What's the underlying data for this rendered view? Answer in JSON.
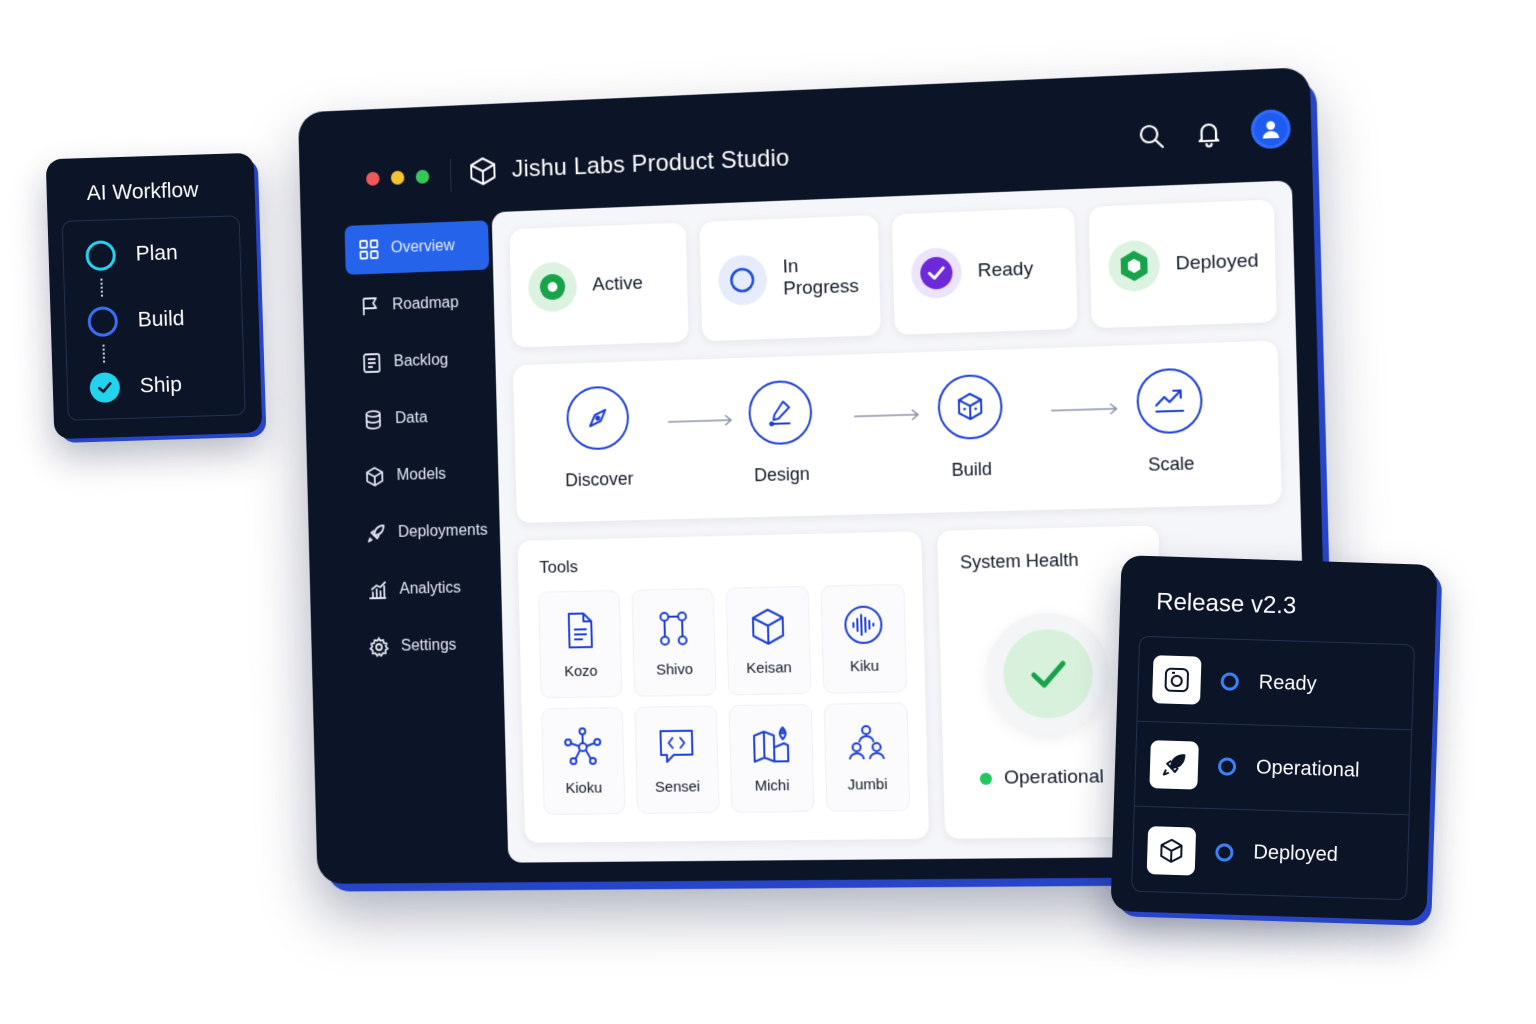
{
  "app": {
    "title": "Jishu Labs Product Studio"
  },
  "sidebar": {
    "items": [
      {
        "label": "Overview",
        "icon": "grid-icon",
        "active": true
      },
      {
        "label": "Roadmap",
        "icon": "flag-icon"
      },
      {
        "label": "Backlog",
        "icon": "list-icon"
      },
      {
        "label": "Data",
        "icon": "database-icon"
      },
      {
        "label": "Models",
        "icon": "cube-icon"
      },
      {
        "label": "Deployments",
        "icon": "rocket-icon"
      },
      {
        "label": "Analytics",
        "icon": "chart-icon"
      },
      {
        "label": "Settings",
        "icon": "gear-icon"
      }
    ]
  },
  "statuses": [
    {
      "label": "Active",
      "icon": "active-dot-icon",
      "color": "#16a34a"
    },
    {
      "label": "In Progress",
      "icon": "progress-ring-icon",
      "color": "#1d4ed8"
    },
    {
      "label": "Ready",
      "icon": "check-badge-icon",
      "color": "#6d28d9"
    },
    {
      "label": "Deployed",
      "icon": "hexagon-icon",
      "color": "#16a34a"
    }
  ],
  "flow": {
    "steps": [
      {
        "label": "Discover",
        "icon": "compass-icon"
      },
      {
        "label": "Design",
        "icon": "pen-tool-icon"
      },
      {
        "label": "Build",
        "icon": "box-icon"
      },
      {
        "label": "Scale",
        "icon": "trend-up-icon"
      }
    ]
  },
  "tools": {
    "title": "Tools",
    "items": [
      {
        "label": "Kozo",
        "icon": "document-icon"
      },
      {
        "label": "Shivo",
        "icon": "branch-icon"
      },
      {
        "label": "Keisan",
        "icon": "cube-icon"
      },
      {
        "label": "Kiku",
        "icon": "audio-wave-icon"
      },
      {
        "label": "Kioku",
        "icon": "network-icon"
      },
      {
        "label": "Sensei",
        "icon": "code-chat-icon"
      },
      {
        "label": "Michi",
        "icon": "map-pin-icon"
      },
      {
        "label": "Jumbi",
        "icon": "team-icon"
      }
    ]
  },
  "health": {
    "title": "System Health",
    "status": "Operational"
  },
  "workflow": {
    "title": "AI Workflow",
    "steps": [
      {
        "label": "Plan",
        "color": "#22d3ee"
      },
      {
        "label": "Build",
        "color": "#3b6df6"
      },
      {
        "label": "Ship",
        "color": "#22d3ee"
      }
    ]
  },
  "release": {
    "title": "Release v2.3",
    "items": [
      {
        "label": "Ready",
        "icon": "camera-icon"
      },
      {
        "label": "Operational",
        "icon": "rocket-icon"
      },
      {
        "label": "Deployed",
        "icon": "cube-icon"
      }
    ]
  },
  "colors": {
    "navy": "#0c1428",
    "accent": "#2563eb",
    "icon_blue": "#1d3fd6"
  }
}
